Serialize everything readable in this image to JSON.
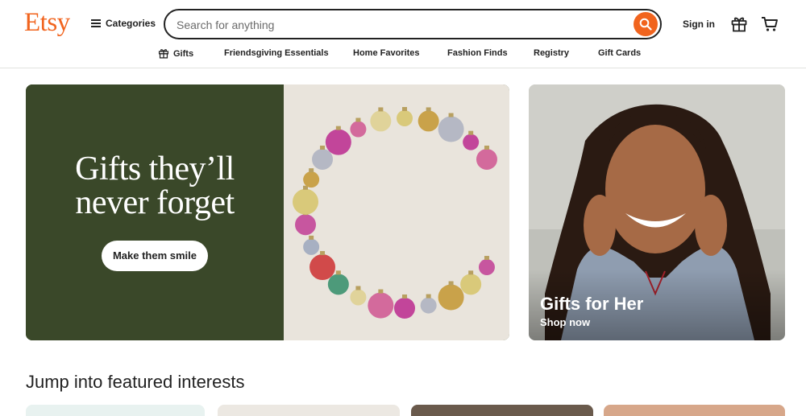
{
  "header": {
    "logo": "Etsy",
    "categories_label": "Categories",
    "search_placeholder": "Search for anything",
    "search_value": "",
    "signin_label": "Sign in"
  },
  "nav": [
    {
      "label": "Gifts",
      "icon": "gift-icon"
    },
    {
      "label": "Friendsgiving Essentials"
    },
    {
      "label": "Home Favorites"
    },
    {
      "label": "Fashion Finds"
    },
    {
      "label": "Registry"
    },
    {
      "label": "Gift Cards"
    }
  ],
  "hero": {
    "title_line1": "Gifts they’ll",
    "title_line2": "never forget",
    "button_label": "Make them smile",
    "bg_color": "#3a4829"
  },
  "promo": {
    "title": "Gifts for Her",
    "subtitle": "Shop now"
  },
  "featured": {
    "heading": "Jump into featured interests"
  },
  "colors": {
    "brand": "#f1641e",
    "text": "#222222",
    "hero_green": "#3a4829"
  }
}
